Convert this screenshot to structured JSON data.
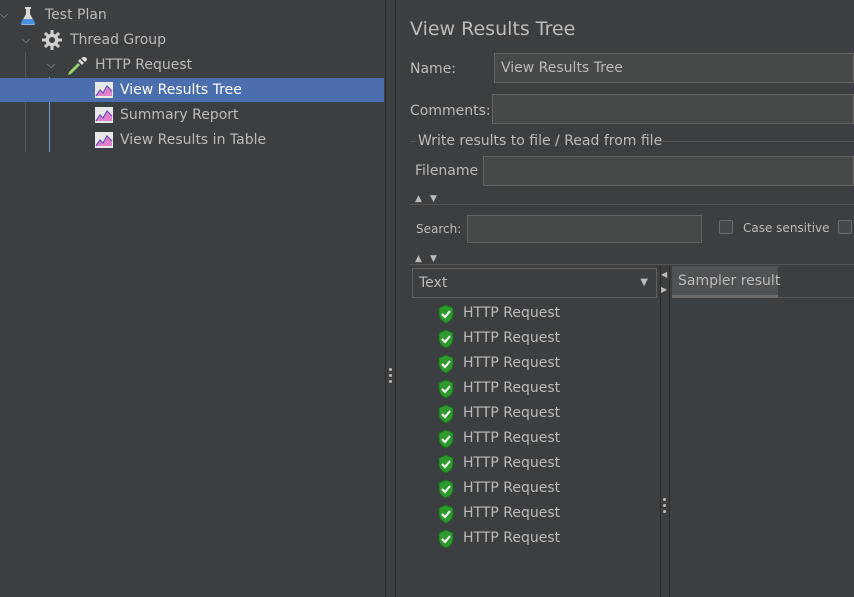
{
  "tree": {
    "items": [
      {
        "label": "Test Plan",
        "icon": "flask-icon",
        "expanded": true
      },
      {
        "label": "Thread Group",
        "icon": "gear-icon",
        "expanded": true
      },
      {
        "label": "HTTP Request",
        "icon": "pipette-icon",
        "expanded": true
      },
      {
        "label": "View Results Tree",
        "icon": "chart-icon",
        "selected": true
      },
      {
        "label": "Summary Report",
        "icon": "chart-icon"
      },
      {
        "label": "View Results in Table",
        "icon": "chart-icon"
      }
    ]
  },
  "panel": {
    "title": "View Results Tree",
    "name_label": "Name:",
    "name_value": "View Results Tree",
    "comments_label": "Comments:",
    "comments_value": "",
    "file_group_label": "Write results to file / Read from file",
    "filename_label": "Filename",
    "filename_value": "",
    "search_label": "Search:",
    "search_value": "",
    "case_sensitive_label": "Case sensitive",
    "renderer_value": "Text",
    "sampler_tab_label": "Sampler result",
    "results": [
      "HTTP Request",
      "HTTP Request",
      "HTTP Request",
      "HTTP Request",
      "HTTP Request",
      "HTTP Request",
      "HTTP Request",
      "HTTP Request",
      "HTTP Request",
      "HTTP Request"
    ]
  },
  "colors": {
    "background": "#3c3f41",
    "selection": "#4b6eaf",
    "success": "#3fa83f"
  }
}
